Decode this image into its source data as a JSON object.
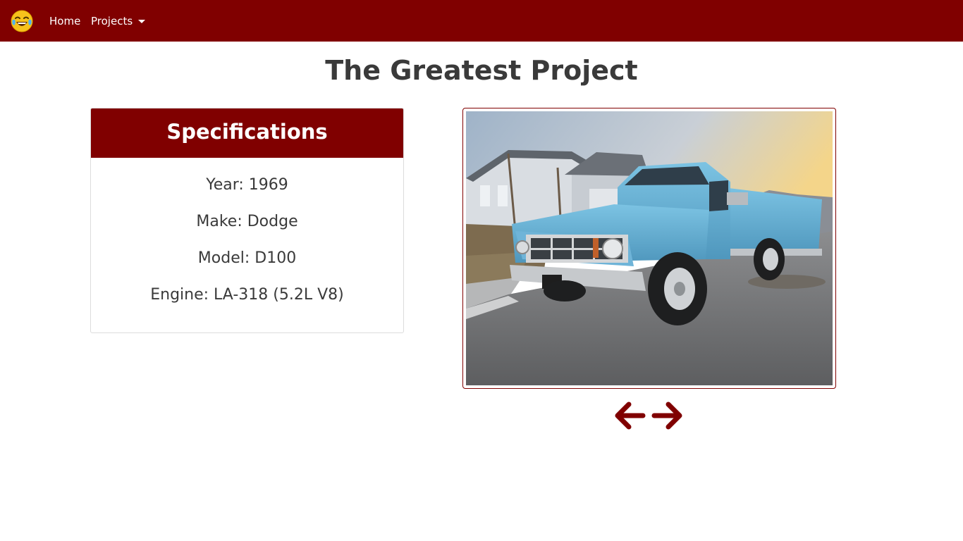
{
  "nav": {
    "logo_icon": "face-with-tears-of-joy-icon",
    "home_label": "Home",
    "projects_label": "Projects",
    "accent_color": "#800000"
  },
  "page": {
    "title": "The Greatest Project"
  },
  "specs": {
    "header": "Specifications",
    "rows": [
      "Year: 1969",
      "Make: Dodge",
      "Model: D100",
      "Engine: LA-318 (5.2L V8)"
    ]
  },
  "gallery": {
    "image_icon": "blue-pickup-truck-photo",
    "prev_icon": "arrow-left-icon",
    "next_icon": "arrow-right-icon"
  }
}
